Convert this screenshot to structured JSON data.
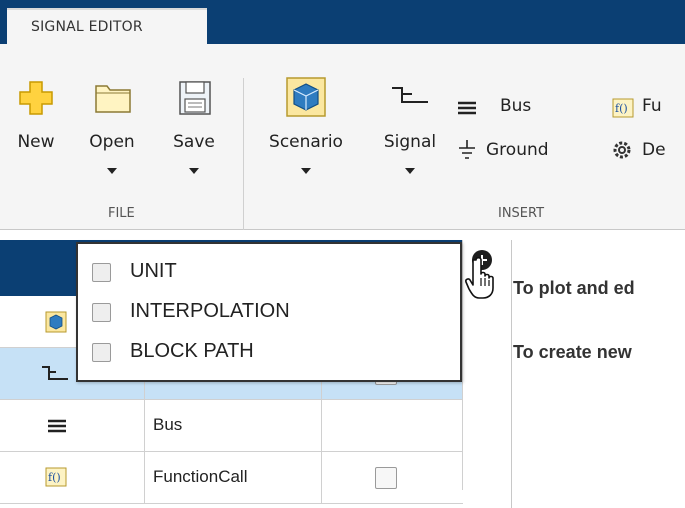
{
  "tabs": {
    "active": "SIGNAL EDITOR"
  },
  "toolstrip": {
    "file": {
      "section_label": "FILE",
      "new_label": "New",
      "open_label": "Open",
      "save_label": "Save"
    },
    "insert": {
      "section_label": "INSERT",
      "scenario_label": "Scenario",
      "signal_label": "Signal",
      "bus_label": "Bus",
      "ground_label": "Ground",
      "functioncall_label": "Fu",
      "d_label": "De"
    }
  },
  "popup": {
    "options": [
      {
        "label": "UNIT",
        "checked": false
      },
      {
        "label": "INTERPOLATION",
        "checked": false
      },
      {
        "label": "BLOCK PATH",
        "checked": false
      }
    ]
  },
  "table": {
    "rows": [
      {
        "icon": "scenario-icon",
        "name": "",
        "checkbox": false
      },
      {
        "icon": "signal-icon",
        "name": "",
        "checkbox": true
      },
      {
        "icon": "bus-icon",
        "name": "Bus",
        "checkbox": false
      },
      {
        "icon": "function-call-icon",
        "name": "FunctionCall",
        "checkbox": true
      }
    ]
  },
  "right_panel": {
    "line1": "To plot and ed",
    "line2": "To create new"
  },
  "colors": {
    "header_blue": "#0b3f73",
    "selected_row": "#c6e1f6",
    "toolstrip_bg": "#f5f5f5"
  }
}
